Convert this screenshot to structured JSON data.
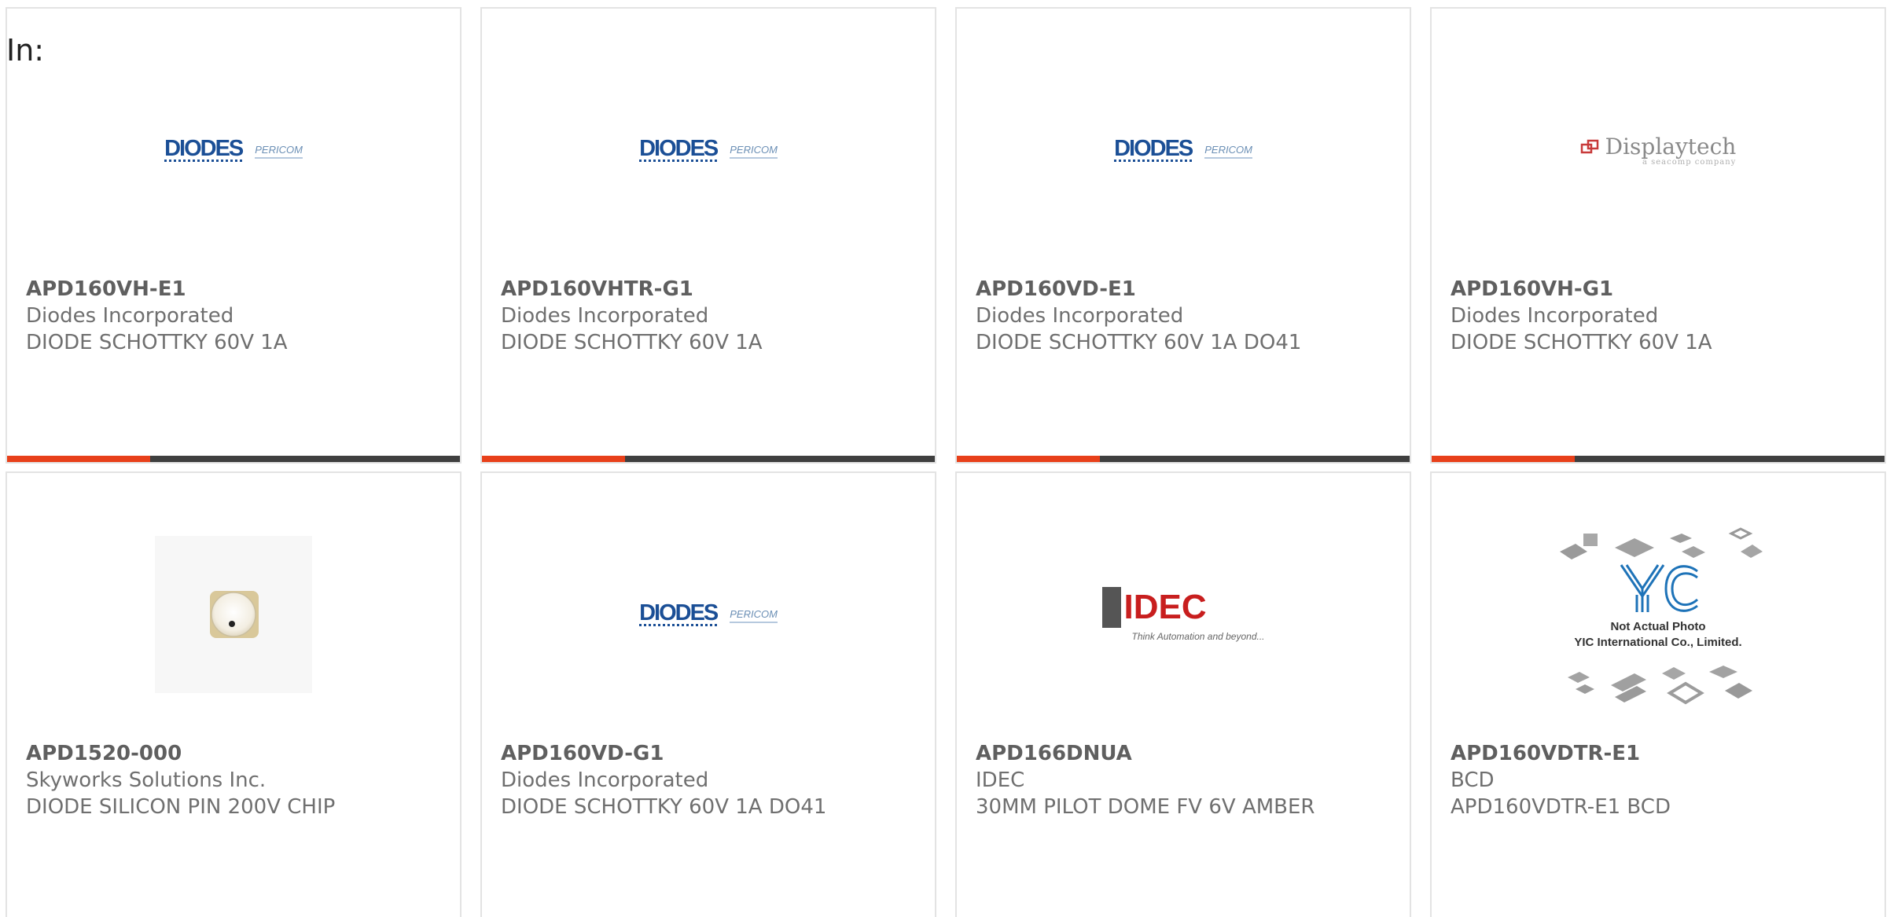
{
  "filter": {
    "label": "In:"
  },
  "products": [
    {
      "part_number": "APD160VH-E1",
      "manufacturer": "Diodes Incorporated",
      "description": "DIODE SCHOTTKY 60V 1A",
      "logo": "diodes-pericom-logo",
      "logo_text": {
        "primary": "DIODES",
        "secondary": "PERICOM"
      }
    },
    {
      "part_number": "APD160VHTR-G1",
      "manufacturer": "Diodes Incorporated",
      "description": "DIODE SCHOTTKY 60V 1A",
      "logo": "diodes-pericom-logo",
      "logo_text": {
        "primary": "DIODES",
        "secondary": "PERICOM"
      }
    },
    {
      "part_number": "APD160VD-E1",
      "manufacturer": "Diodes Incorporated",
      "description": "DIODE SCHOTTKY 60V 1A DO41",
      "logo": "diodes-pericom-logo",
      "logo_text": {
        "primary": "DIODES",
        "secondary": "PERICOM"
      }
    },
    {
      "part_number": "APD160VH-G1",
      "manufacturer": "Diodes Incorporated",
      "description": "DIODE SCHOTTKY 60V 1A",
      "logo": "displaytech-logo",
      "logo_text": {
        "primary": "Displaytech",
        "secondary": "a seacomp company"
      }
    },
    {
      "part_number": "APD1520-000",
      "manufacturer": "Skyworks Solutions Inc.",
      "description": "DIODE SILICON PIN 200V CHIP",
      "logo": "chip-photo"
    },
    {
      "part_number": "APD160VD-G1",
      "manufacturer": "Diodes Incorporated",
      "description": "DIODE SCHOTTKY 60V 1A DO41",
      "logo": "diodes-pericom-logo",
      "logo_text": {
        "primary": "DIODES",
        "secondary": "PERICOM"
      }
    },
    {
      "part_number": "APD166DNUA",
      "manufacturer": "IDEC",
      "description": "30MM PILOT DOME FV 6V AMBER",
      "logo": "idec-logo",
      "logo_text": {
        "primary": "IDEC",
        "secondary": "Think Automation and beyond..."
      }
    },
    {
      "part_number": "APD160VDTR-E1",
      "manufacturer": "BCD",
      "description": "APD160VDTR-E1 BCD",
      "logo": "yic-not-actual-photo",
      "logo_text": {
        "primary": "Not Actual Photo",
        "secondary": "YIC International Co., Limited."
      }
    }
  ],
  "colors": {
    "accent": "#e8401a",
    "bar": "#3f3f3f",
    "border": "#e3e3e3",
    "text": "#6f6f6f"
  }
}
